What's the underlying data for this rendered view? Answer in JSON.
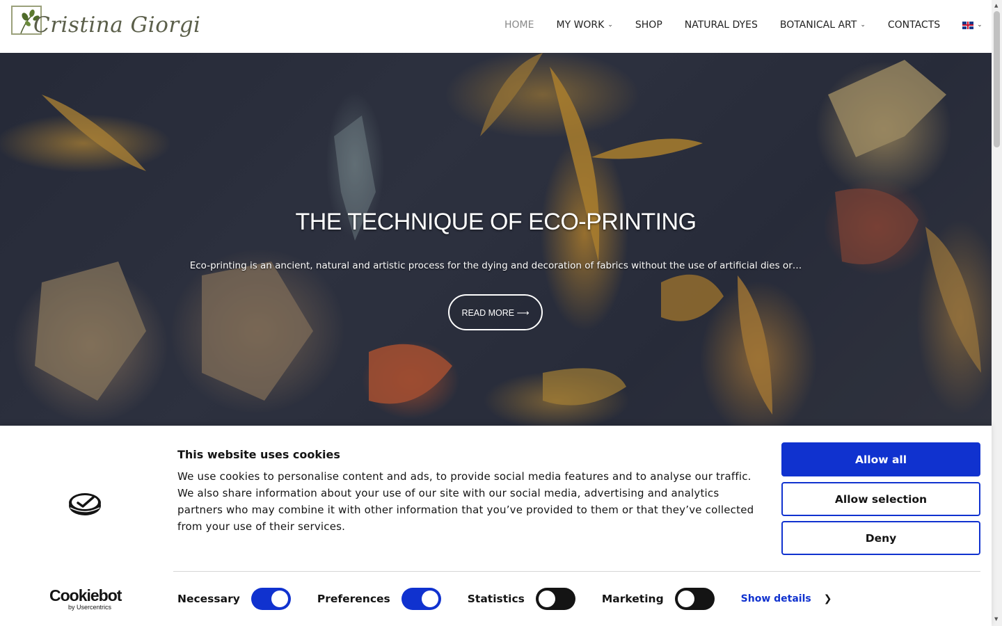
{
  "header": {
    "logo_text": "Cristina Giorgi",
    "nav": [
      {
        "label": "HOME",
        "has_dropdown": false,
        "active": true
      },
      {
        "label": "MY WORK",
        "has_dropdown": true
      },
      {
        "label": "SHOP",
        "has_dropdown": false
      },
      {
        "label": "NATURAL DYES",
        "has_dropdown": false
      },
      {
        "label": "BOTANICAL ART",
        "has_dropdown": true
      },
      {
        "label": "CONTACTS",
        "has_dropdown": false
      }
    ],
    "language_icon": "uk-flag-icon"
  },
  "hero": {
    "title": "THE TECHNIQUE OF ECO-PRINTING",
    "text": "Eco-printing is an ancient, natural and artistic process for the dying and decoration of fabrics without the use of artificial dies or…",
    "button_label": "READ MORE ⟶"
  },
  "cookie_banner": {
    "brand_name": "Cookiebot",
    "brand_sub": "by Usercentrics",
    "title": "This website uses cookies",
    "body": "We use cookies to personalise content and ads, to provide social media features and to analyse our traffic. We also share information about your use of our site with our social media, advertising and analytics partners who may combine it with other information that you’ve provided to them or that they’ve collected from your use of their services.",
    "buttons": {
      "allow_all": "Allow all",
      "allow_selection": "Allow selection",
      "deny": "Deny"
    },
    "toggles": [
      {
        "label": "Necessary",
        "on": true
      },
      {
        "label": "Preferences",
        "on": true
      },
      {
        "label": "Statistics",
        "on": false
      },
      {
        "label": "Marketing",
        "on": false
      }
    ],
    "show_details": "Show details",
    "accent_color": "#1032cf"
  }
}
